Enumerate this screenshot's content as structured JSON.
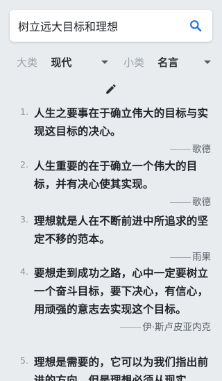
{
  "search": {
    "value": "树立远大目标和理想"
  },
  "filters": {
    "category_label": "大类",
    "category_value": "现代",
    "subcategory_label": "小类",
    "subcategory_value": "名言"
  },
  "quotes": [
    {
      "num": "1.",
      "text": "人生之要事在于确立伟大的目标与实现这目标的决心。",
      "author": "歌德"
    },
    {
      "num": "2.",
      "text": "人生重要的在于确立一个伟大的目标，并有决心使其实现。",
      "author": "歌德"
    },
    {
      "num": "3.",
      "text": "理想就是人在不断前进中所追求的坚定不移的范本。",
      "author": "雨果"
    },
    {
      "num": "4.",
      "text": "要想走到成功之路，心中一定要树立一个奋斗目标，要下决心，有信心，用顽强的意志去实现这个目标。",
      "author": "伊·斯卢皮亚内克"
    },
    {
      "num": "5.",
      "text": "理想是需要的，它可以为我们指出前进的方向，但是理想必须从现实",
      "author": ""
    }
  ],
  "colors": {
    "accent": "#1a73e8",
    "background": "#e9ecef"
  }
}
